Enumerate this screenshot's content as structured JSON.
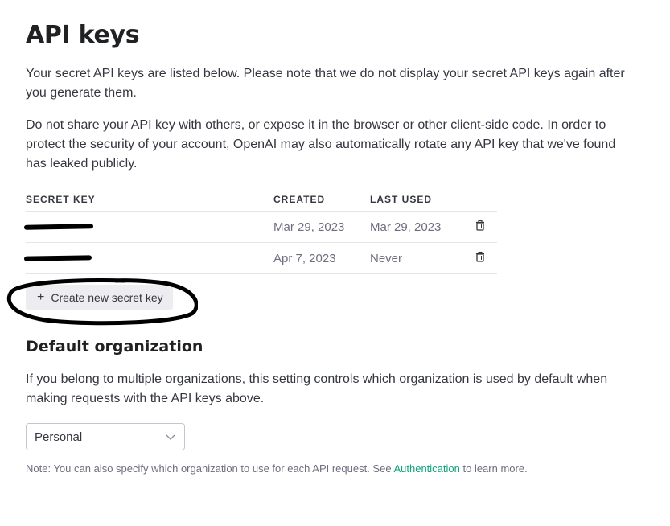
{
  "page": {
    "title": "API keys",
    "intro": "Your secret API keys are listed below. Please note that we do not display your secret API keys again after you generate them.",
    "warning": "Do not share your API key with others, or expose it in the browser or other client-side code. In order to protect the security of your account, OpenAI may also automatically rotate any API key that we've found has leaked publicly."
  },
  "keys_table": {
    "headers": {
      "secret_key": "SECRET KEY",
      "created": "CREATED",
      "last_used": "LAST USED"
    },
    "rows": [
      {
        "created": "Mar 29, 2023",
        "last_used": "Mar 29, 2023"
      },
      {
        "created": "Apr 7, 2023",
        "last_used": "Never"
      }
    ]
  },
  "create_button": {
    "icon": "+",
    "label": "Create new secret key"
  },
  "default_org": {
    "heading": "Default organization",
    "description": "If you belong to multiple organizations, this setting controls which organization is used by default when making requests with the API keys above.",
    "select_value": "Personal",
    "note_prefix": "Note: You can also specify which organization to use for each API request. See ",
    "note_link": "Authentication",
    "note_suffix": " to learn more."
  },
  "colors": {
    "link": "#10a37f",
    "button_bg": "#ececf1",
    "text": "#353740",
    "muted": "#6e6e80",
    "annotation": "#000000"
  },
  "icons": {
    "delete": "trash-icon",
    "dropdown": "chevron-down-icon"
  }
}
